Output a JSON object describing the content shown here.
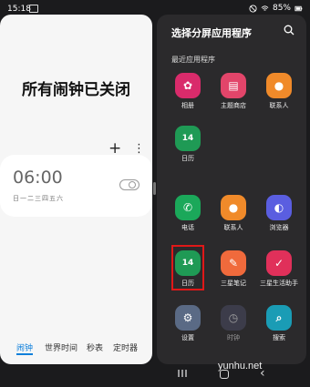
{
  "status_bar": {
    "time": "15:18",
    "battery": "85%"
  },
  "clock_app": {
    "title": "所有闹钟已关闭",
    "alarm": {
      "time": "06:00",
      "days": "日一二三四五六",
      "enabled": false
    },
    "tabs": [
      {
        "label": "闹钟",
        "active": true
      },
      {
        "label": "世界时间",
        "active": false
      },
      {
        "label": "秒表",
        "active": false
      },
      {
        "label": "定时器",
        "active": false
      }
    ]
  },
  "app_picker": {
    "title": "选择分屏应用程序",
    "recent_label": "最近应用程序",
    "recent_apps": [
      {
        "label": "相册",
        "icon": "flower-icon",
        "color": "#d92b6b"
      },
      {
        "label": "主题商店",
        "icon": "theme-store-icon",
        "color": "#e2456a"
      },
      {
        "label": "联系人",
        "icon": "contact-icon",
        "color": "#f08a2a"
      },
      {
        "label": "日历",
        "icon": "calendar-icon",
        "color": "#1f9a55",
        "glyph": "14"
      }
    ],
    "all_apps": [
      {
        "label": "电话",
        "icon": "phone-icon",
        "color": "#1ba85a"
      },
      {
        "label": "联系人",
        "icon": "contact-icon",
        "color": "#f08a2a"
      },
      {
        "label": "浏览器",
        "icon": "browser-icon",
        "color": "#5a5ee0"
      },
      {
        "label": "日历",
        "icon": "calendar-icon",
        "color": "#1f9a55",
        "glyph": "14",
        "highlighted": true
      },
      {
        "label": "三星笔记",
        "icon": "notes-icon",
        "color": "#f06a3c"
      },
      {
        "label": "三星生活助手",
        "icon": "reminder-icon",
        "color": "#e0305a"
      },
      {
        "label": "设置",
        "icon": "gear-icon",
        "color": "#5a6a85"
      },
      {
        "label": "时钟",
        "icon": "clock-icon",
        "color": "#4a4c63"
      },
      {
        "label": "搜索",
        "icon": "search-app-icon",
        "color": "#1a9cb5"
      }
    ]
  },
  "watermark": "yunhu.net"
}
